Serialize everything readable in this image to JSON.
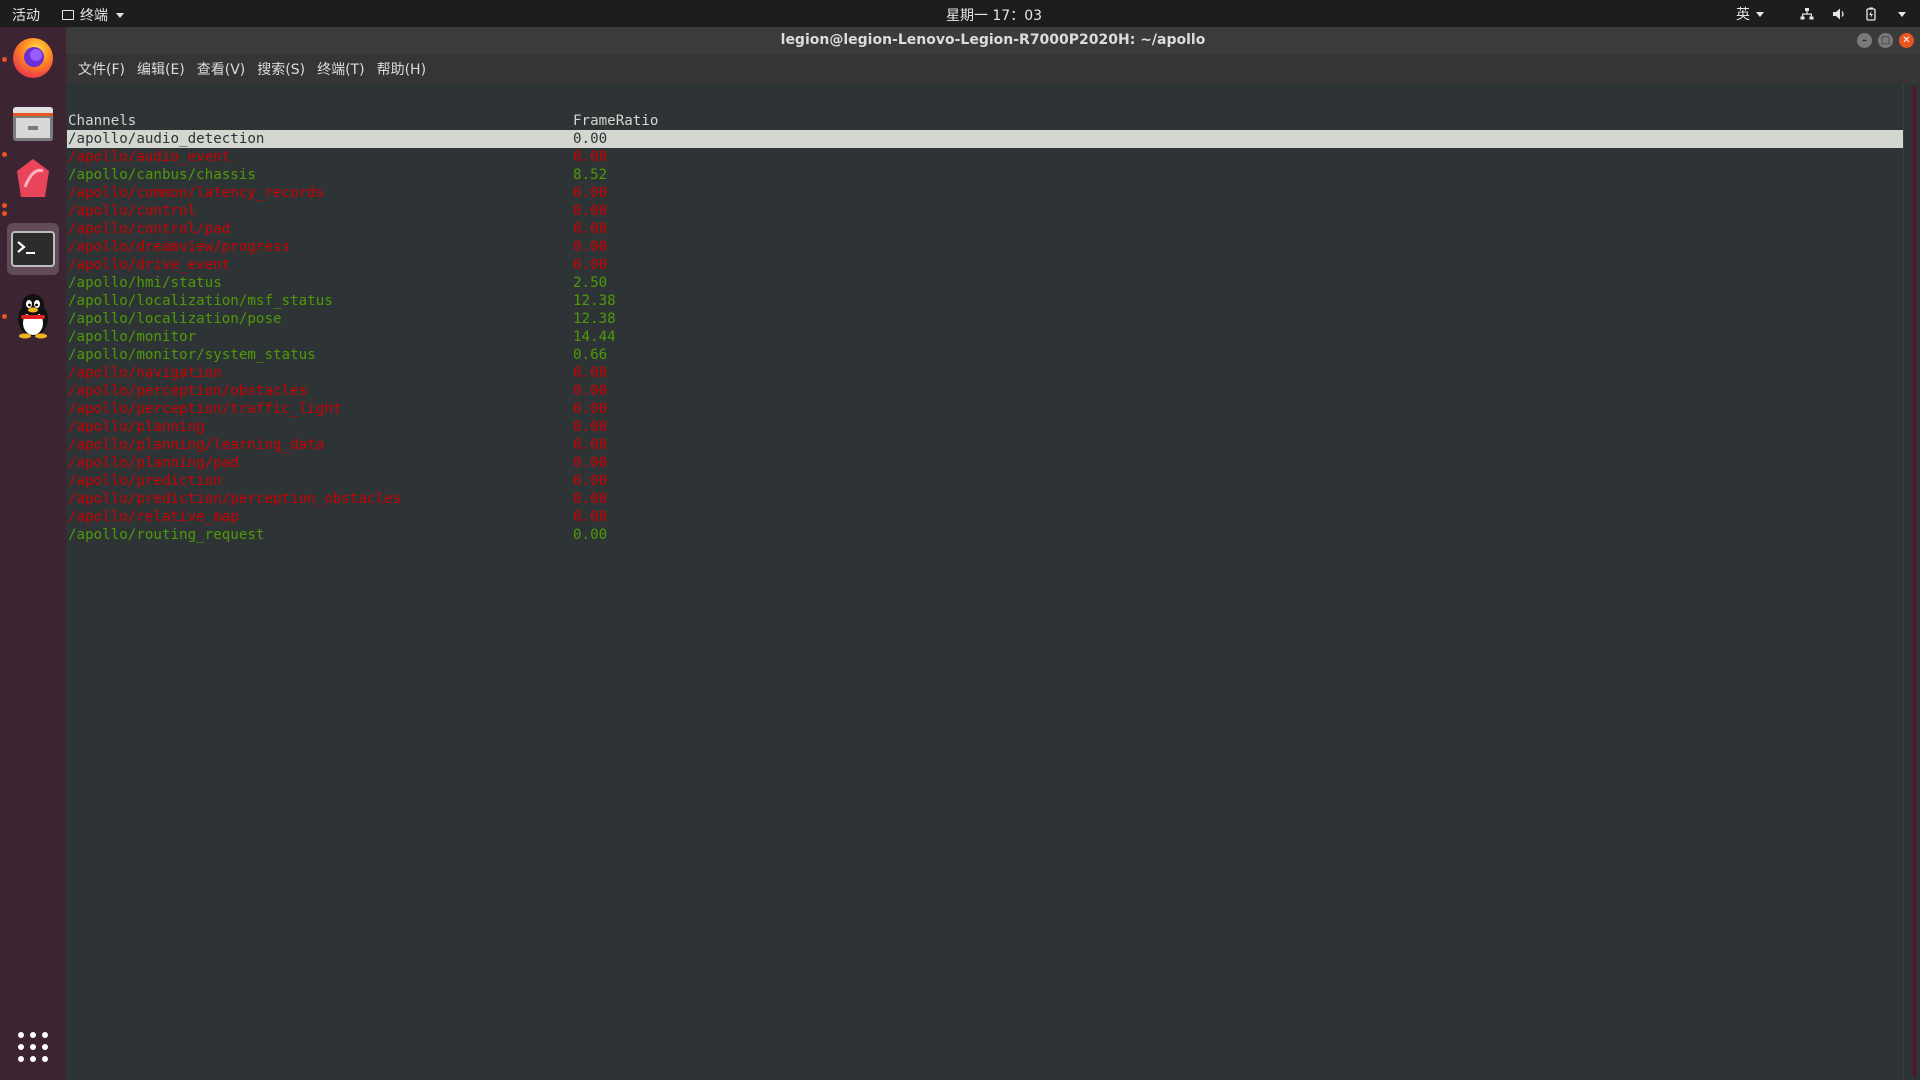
{
  "topbar": {
    "activities": "活动",
    "app_name": "终端",
    "clock": "星期一 17：03",
    "ime": "英"
  },
  "dock": {
    "items": [
      {
        "name": "firefox",
        "running": true
      },
      {
        "name": "files",
        "running": false
      },
      {
        "name": "app-red",
        "running": true
      },
      {
        "name": "terminal",
        "running": true,
        "active": true
      },
      {
        "name": "qq",
        "running": true
      }
    ]
  },
  "window": {
    "title": "legion@legion-Lenovo-Legion-R7000P2020H: ~/apollo"
  },
  "menubar": {
    "items": [
      "文件(F)",
      "编辑(E)",
      "查看(V)",
      "搜索(S)",
      "终端(T)",
      "帮助(H)"
    ]
  },
  "terminal": {
    "header": {
      "channels": "Channels",
      "frame_ratio": "FrameRatio"
    },
    "rows": [
      {
        "channel": "/apollo/audio_detection",
        "ratio": "0.00",
        "status": "selected"
      },
      {
        "channel": "/apollo/audio_event",
        "ratio": "0.00",
        "status": "red"
      },
      {
        "channel": "/apollo/canbus/chassis",
        "ratio": "8.52",
        "status": "green"
      },
      {
        "channel": "/apollo/common/latency_records",
        "ratio": "0.00",
        "status": "red"
      },
      {
        "channel": "/apollo/control",
        "ratio": "0.00",
        "status": "red"
      },
      {
        "channel": "/apollo/control/pad",
        "ratio": "0.00",
        "status": "red"
      },
      {
        "channel": "/apollo/dreamview/progress",
        "ratio": "0.00",
        "status": "red"
      },
      {
        "channel": "/apollo/drive_event",
        "ratio": "0.00",
        "status": "red"
      },
      {
        "channel": "/apollo/hmi/status",
        "ratio": "2.50",
        "status": "green"
      },
      {
        "channel": "/apollo/localization/msf_status",
        "ratio": "12.38",
        "status": "green"
      },
      {
        "channel": "/apollo/localization/pose",
        "ratio": "12.38",
        "status": "green"
      },
      {
        "channel": "/apollo/monitor",
        "ratio": "14.44",
        "status": "green"
      },
      {
        "channel": "/apollo/monitor/system_status",
        "ratio": "0.66",
        "status": "green"
      },
      {
        "channel": "/apollo/navigation",
        "ratio": "0.00",
        "status": "red"
      },
      {
        "channel": "/apollo/perception/obstacles",
        "ratio": "0.00",
        "status": "red"
      },
      {
        "channel": "/apollo/perception/traffic_light",
        "ratio": "0.00",
        "status": "red"
      },
      {
        "channel": "/apollo/planning",
        "ratio": "0.00",
        "status": "red"
      },
      {
        "channel": "/apollo/planning/learning_data",
        "ratio": "0.00",
        "status": "red"
      },
      {
        "channel": "/apollo/planning/pad",
        "ratio": "0.00",
        "status": "red"
      },
      {
        "channel": "/apollo/prediction",
        "ratio": "0.00",
        "status": "red"
      },
      {
        "channel": "/apollo/prediction/perception_obstacles",
        "ratio": "0.00",
        "status": "red"
      },
      {
        "channel": "/apollo/relative_map",
        "ratio": "0.00",
        "status": "red"
      },
      {
        "channel": "/apollo/routing_request",
        "ratio": "0.00",
        "status": "green"
      }
    ]
  },
  "colors": {
    "green": "#4e9a06",
    "red": "#cc0000",
    "selected_bg": "#d3d7cf",
    "terminal_bg": "#2e3436",
    "dock_bg": "#3d2433",
    "accent": "#e95420"
  }
}
